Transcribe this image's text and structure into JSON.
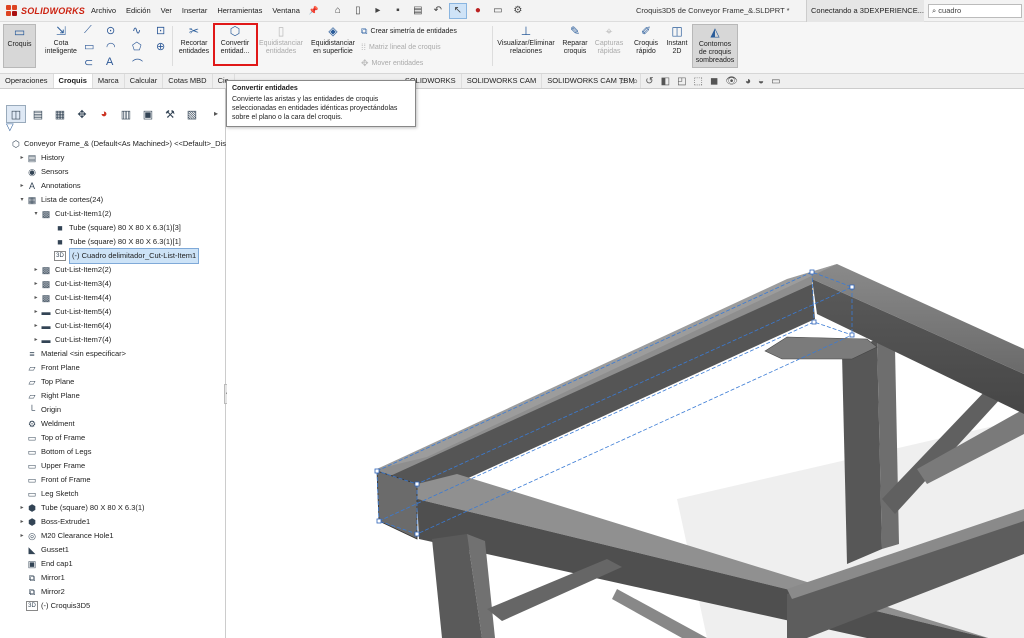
{
  "app": {
    "brand": "SOLIDWORKS",
    "doc_title": "Croquis3D5 de Conveyor Frame_&.SLDPRT *",
    "connect": "Conectando a 3DEXPERIENCE...",
    "search_value": "cuadro"
  },
  "menu": [
    "Archivo",
    "Edición",
    "Ver",
    "Insertar",
    "Herramientas",
    "Ventana"
  ],
  "ribbon": {
    "croquis": "Croquis",
    "cota": [
      "Cota",
      "inteligente"
    ],
    "recortar": [
      "Recortar",
      "entidades"
    ],
    "convertir": [
      "Convertir",
      "entidad..."
    ],
    "equidistanciar": [
      "Equidistanciar",
      "entidades"
    ],
    "equi_superficie": [
      "Equidistanciar",
      "en superficie"
    ],
    "simetria": "Crear simetría de entidades",
    "matriz": "Matriz lineal de croquis",
    "mover": "Mover entidades",
    "visualizar": [
      "Visualizar/Eliminar",
      "relaciones"
    ],
    "reparar": [
      "Reparar",
      "croquis"
    ],
    "capturas": [
      "Capturas",
      "rápidas"
    ],
    "croquis_rapido": [
      "Croquis",
      "rápido"
    ],
    "instant2d": [
      "Instant",
      "2D"
    ],
    "contornos": [
      "Contornos",
      "de croquis",
      "sombreados"
    ]
  },
  "tabs": [
    "Operaciones",
    "Croquis",
    "Marca",
    "Calcular",
    "Cotas MBD",
    "Cie",
    "SOLIDWORKS",
    "SOLIDWORKS CAM",
    "SOLIDWORKS CAM TBM"
  ],
  "tooltip": {
    "title": "Convertir entidades",
    "body": "Convierte las aristas y las entidades de croquis seleccionadas en entidades idénticas proyectándolas sobre el plano o la cara del croquis."
  },
  "tree": [
    {
      "label": "Conveyor Frame_& (Default<As Machined>) <<Default>_Dis",
      "indent": 0,
      "exp": "",
      "icon": "part-icon",
      "glyph": "⬡"
    },
    {
      "label": "History",
      "indent": 1,
      "exp": "▸",
      "icon": "history-icon",
      "glyph": "▤"
    },
    {
      "label": "Sensors",
      "indent": 1,
      "exp": "",
      "icon": "sensor-icon",
      "glyph": "◉"
    },
    {
      "label": "Annotations",
      "indent": 1,
      "exp": "▸",
      "icon": "annotation-icon",
      "glyph": "A"
    },
    {
      "label": "Lista de cortes(24)",
      "indent": 1,
      "exp": "▾",
      "icon": "cutlist-icon",
      "glyph": "▦"
    },
    {
      "label": "Cut-List-Item1(2)",
      "indent": 2,
      "exp": "▾",
      "icon": "weldment-icon",
      "glyph": "▩"
    },
    {
      "label": "Tube (square) 80 X 80 X 6.3(1)[3]",
      "indent": 3,
      "exp": "",
      "icon": "body-icon",
      "glyph": "■"
    },
    {
      "label": "Tube (square) 80 X 80 X 6.3(1)[1]",
      "indent": 3,
      "exp": "",
      "icon": "body-icon",
      "glyph": "■"
    },
    {
      "label": "(-) Cuadro delimitador_Cut-List-Item1",
      "indent": 3,
      "exp": "",
      "icon": "3dsketch-icon",
      "glyph": "3D",
      "selected": true
    },
    {
      "label": "Cut-List-Item2(2)",
      "indent": 2,
      "exp": "▸",
      "icon": "weldment-icon",
      "glyph": "▩"
    },
    {
      "label": "Cut-List-Item3(4)",
      "indent": 2,
      "exp": "▸",
      "icon": "weldment-icon",
      "glyph": "▩"
    },
    {
      "label": "Cut-List-Item4(4)",
      "indent": 2,
      "exp": "▸",
      "icon": "weldment-icon",
      "glyph": "▩"
    },
    {
      "label": "Cut-List-Item5(4)",
      "indent": 2,
      "exp": "▸",
      "icon": "folder-icon",
      "glyph": "▬"
    },
    {
      "label": "Cut-List-Item6(4)",
      "indent": 2,
      "exp": "▸",
      "icon": "folder-icon",
      "glyph": "▬"
    },
    {
      "label": "Cut-List-Item7(4)",
      "indent": 2,
      "exp": "▸",
      "icon": "folder-icon",
      "glyph": "▬"
    },
    {
      "label": "Material <sin especificar>",
      "indent": 1,
      "exp": "",
      "icon": "material-icon",
      "glyph": "≡"
    },
    {
      "label": "Front Plane",
      "indent": 1,
      "exp": "",
      "icon": "plane-icon",
      "glyph": "▱"
    },
    {
      "label": "Top Plane",
      "indent": 1,
      "exp": "",
      "icon": "plane-icon",
      "glyph": "▱"
    },
    {
      "label": "Right Plane",
      "indent": 1,
      "exp": "",
      "icon": "plane-icon",
      "glyph": "▱"
    },
    {
      "label": "Origin",
      "indent": 1,
      "exp": "",
      "icon": "origin-icon",
      "glyph": "└"
    },
    {
      "label": "Weldment",
      "indent": 1,
      "exp": "",
      "icon": "weldment-feature-icon",
      "glyph": "⚙"
    },
    {
      "label": "Top of Frame",
      "indent": 1,
      "exp": "",
      "icon": "sketch-icon",
      "glyph": "▭"
    },
    {
      "label": "Bottom of Legs",
      "indent": 1,
      "exp": "",
      "icon": "sketch-icon",
      "glyph": "▭"
    },
    {
      "label": "Upper Frame",
      "indent": 1,
      "exp": "",
      "icon": "sketch-icon",
      "glyph": "▭"
    },
    {
      "label": "Front of Frame",
      "indent": 1,
      "exp": "",
      "icon": "sketch-icon",
      "glyph": "▭"
    },
    {
      "label": "Leg Sketch",
      "indent": 1,
      "exp": "",
      "icon": "sketch-icon",
      "glyph": "▭"
    },
    {
      "label": "Tube (square) 80 X 80 X 6.3(1)",
      "indent": 1,
      "exp": "▸",
      "icon": "structural-member-icon",
      "glyph": "⬢"
    },
    {
      "label": "Boss-Extrude1",
      "indent": 1,
      "exp": "▸",
      "icon": "extrude-icon",
      "glyph": "⬢"
    },
    {
      "label": "M20 Clearance Hole1",
      "indent": 1,
      "exp": "▸",
      "icon": "hole-icon",
      "glyph": "◎"
    },
    {
      "label": "Gusset1",
      "indent": 1,
      "exp": "",
      "icon": "gusset-icon",
      "glyph": "◣"
    },
    {
      "label": "End cap1",
      "indent": 1,
      "exp": "",
      "icon": "endcap-icon",
      "glyph": "▣"
    },
    {
      "label": "Mirror1",
      "indent": 1,
      "exp": "",
      "icon": "mirror-icon",
      "glyph": "⧉"
    },
    {
      "label": "Mirror2",
      "indent": 1,
      "exp": "",
      "icon": "mirror-icon",
      "glyph": "⧉"
    },
    {
      "label": "(-) Croquis3D5",
      "indent": 1,
      "exp": "",
      "icon": "3dsketch-icon",
      "glyph": "3D"
    }
  ]
}
